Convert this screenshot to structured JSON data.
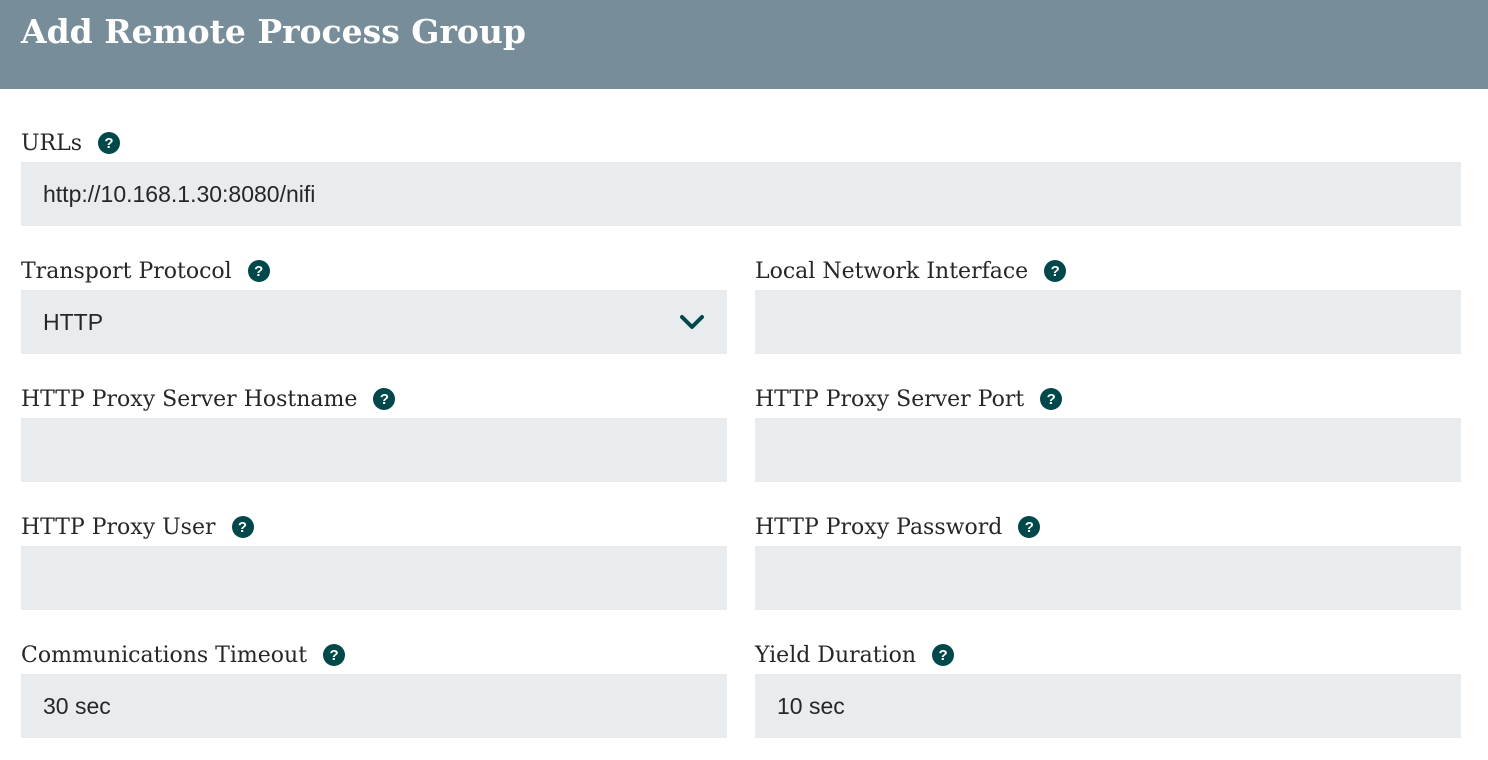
{
  "dialog": {
    "title": "Add Remote Process Group"
  },
  "fields": {
    "urls": {
      "label": "URLs",
      "value": "http://10.168.1.30:8080/nifi"
    },
    "transport_protocol": {
      "label": "Transport Protocol",
      "value": "HTTP"
    },
    "local_network_interface": {
      "label": "Local Network Interface",
      "value": ""
    },
    "proxy_hostname": {
      "label": "HTTP Proxy Server Hostname",
      "value": ""
    },
    "proxy_port": {
      "label": "HTTP Proxy Server Port",
      "value": ""
    },
    "proxy_user": {
      "label": "HTTP Proxy User",
      "value": ""
    },
    "proxy_password": {
      "label": "HTTP Proxy Password",
      "value": ""
    },
    "communications_timeout": {
      "label": "Communications Timeout",
      "value": "30 sec"
    },
    "yield_duration": {
      "label": "Yield Duration",
      "value": "10 sec"
    }
  },
  "icons": {
    "help": "question-circle-icon",
    "dropdown": "chevron-down-icon"
  },
  "colors": {
    "header_bg": "#778d99",
    "input_bg": "#e9ecef",
    "help_icon": "#004849"
  }
}
